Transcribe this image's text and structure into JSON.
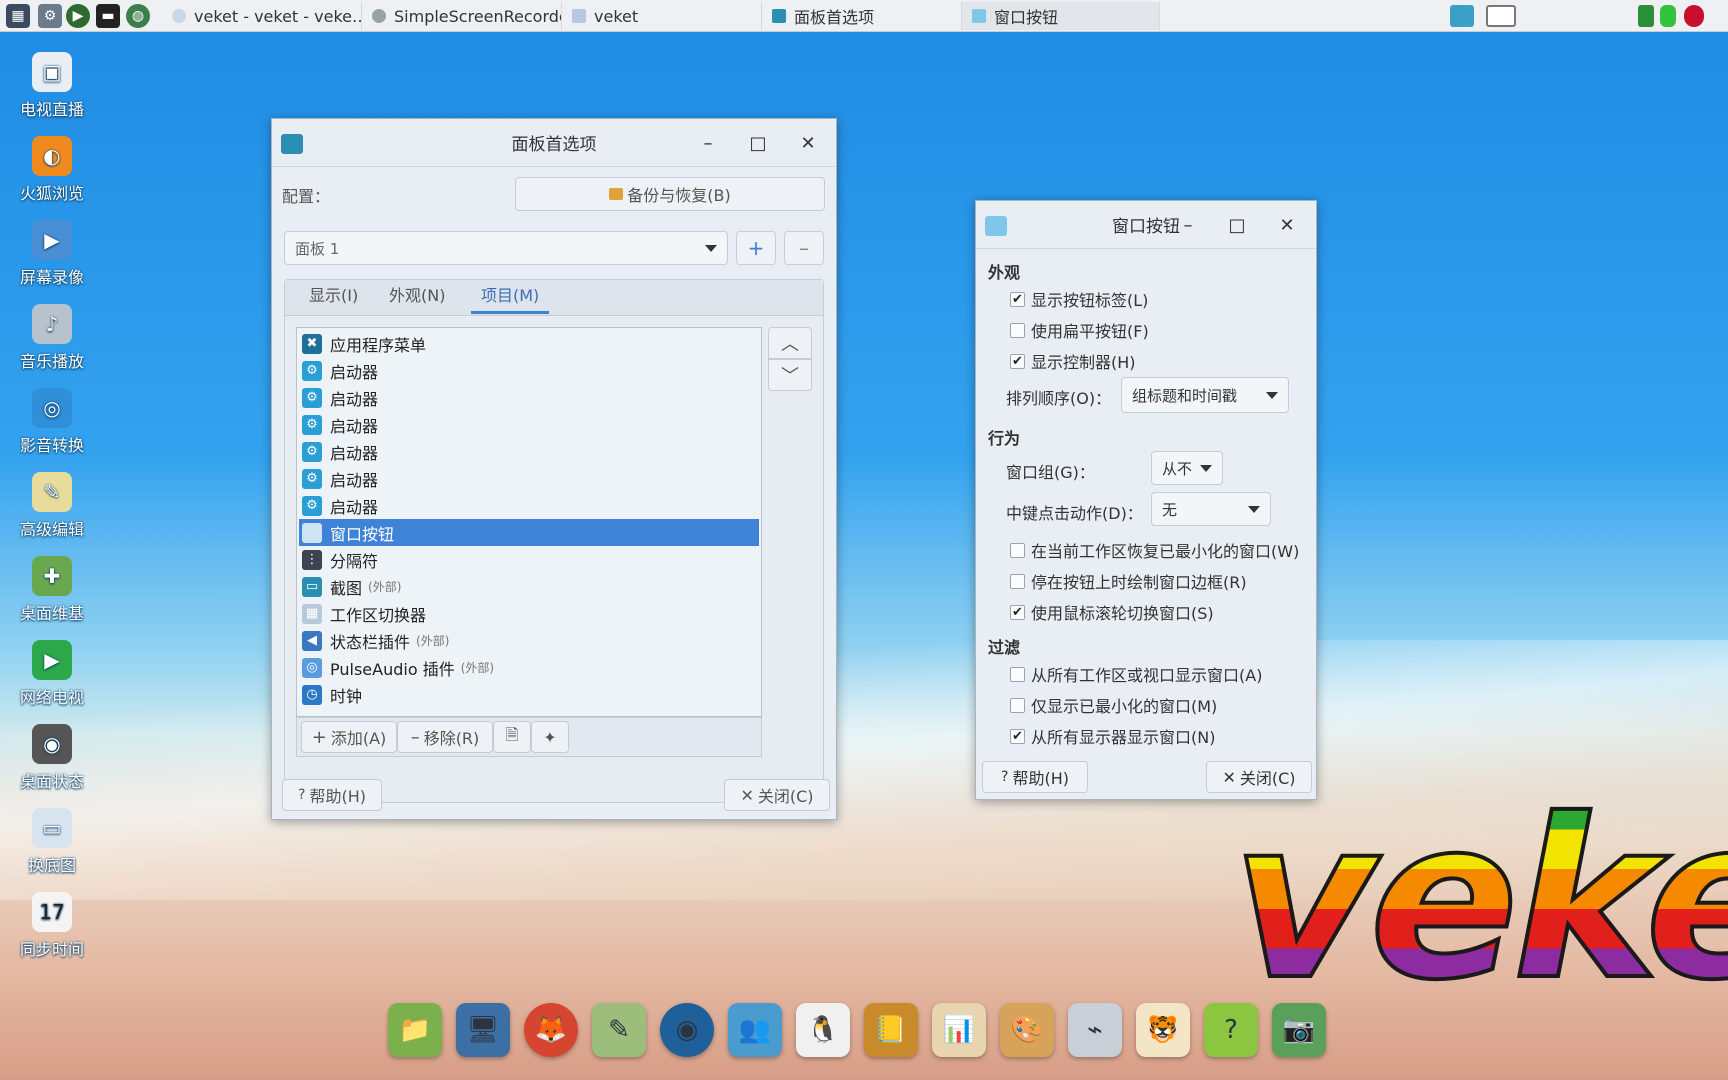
{
  "taskbar": {
    "tasks": [
      {
        "label": "veket - veket - veke…"
      },
      {
        "label": "SimpleScreenRecorder"
      },
      {
        "label": "veket"
      },
      {
        "label": "面板首选项"
      },
      {
        "label": "窗口按钮"
      }
    ]
  },
  "desktop_icons": [
    {
      "label": "电视直播",
      "icon": "tv-icon"
    },
    {
      "label": "火狐浏览",
      "icon": "firefox-icon"
    },
    {
      "label": "屏幕录像",
      "icon": "screen-record-icon"
    },
    {
      "label": "音乐播放",
      "icon": "speaker-icon"
    },
    {
      "label": "影音转换",
      "icon": "media-convert-icon"
    },
    {
      "label": "高级编辑",
      "icon": "text-editor-icon"
    },
    {
      "label": "桌面维基",
      "icon": "desktop-wiki-icon"
    },
    {
      "label": "网络电视",
      "icon": "play-icon"
    },
    {
      "label": "桌面状态",
      "icon": "desktop-status-icon"
    },
    {
      "label": "换底图",
      "icon": "monitor-icon"
    },
    {
      "label": "同步时间",
      "icon": "calendar-icon",
      "day": "17"
    }
  ],
  "panel_prefs": {
    "title": "面板首选项",
    "config_label": "配置：",
    "backup_button": "备份与恢复(B)",
    "panel_combo": "面板 1",
    "tabs": [
      "显示(I)",
      "外观(N)",
      "项目(M)"
    ],
    "selected_tab": "项目(M)",
    "items": [
      {
        "label": "应用程序菜单",
        "ext": "",
        "icon": "app-menu-icon"
      },
      {
        "label": "启动器",
        "ext": "",
        "icon": "launcher-icon"
      },
      {
        "label": "启动器",
        "ext": "",
        "icon": "launcher-icon"
      },
      {
        "label": "启动器",
        "ext": "",
        "icon": "launcher-icon"
      },
      {
        "label": "启动器",
        "ext": "",
        "icon": "launcher-icon"
      },
      {
        "label": "启动器",
        "ext": "",
        "icon": "launcher-icon"
      },
      {
        "label": "启动器",
        "ext": "",
        "icon": "launcher-icon"
      },
      {
        "label": "窗口按钮",
        "ext": "",
        "icon": "window-buttons-icon",
        "selected": true
      },
      {
        "label": "分隔符",
        "ext": "",
        "icon": "separator-icon"
      },
      {
        "label": "截图",
        "ext": "(外部)",
        "icon": "screenshot-icon"
      },
      {
        "label": "工作区切换器",
        "ext": "",
        "icon": "workspace-switcher-icon"
      },
      {
        "label": "状态栏插件",
        "ext": "(外部)",
        "icon": "status-tray-icon"
      },
      {
        "label": "PulseAudio 插件",
        "ext": "(外部)",
        "icon": "pulseaudio-icon"
      },
      {
        "label": "时钟",
        "ext": "",
        "icon": "clock-icon"
      }
    ],
    "add_button": "添加(A)",
    "remove_button": "移除(R)",
    "help_button": "帮助(H)",
    "close_button": "关闭(C)"
  },
  "window_buttons": {
    "title": "窗口按钮",
    "appearance_heading": "外观",
    "show_labels": {
      "label": "显示按钮标签(L)",
      "checked": true
    },
    "flat_buttons": {
      "label": "使用扁平按钮(F)",
      "checked": false
    },
    "show_handle": {
      "label": "显示控制器(H)",
      "checked": true
    },
    "sort_order_label": "排列顺序(O)：",
    "sort_order_value": "组标题和时间戳",
    "behavior_heading": "行为",
    "window_group_label": "窗口组(G)：",
    "window_group_value": "从不",
    "middle_click_label": "中键点击动作(D)：",
    "middle_click_value": "无",
    "restore_minimized": {
      "label": "在当前工作区恢复已最小化的窗口(W)",
      "checked": false
    },
    "draw_border": {
      "label": "停在按钮上时绘制窗口边框(R)",
      "checked": false
    },
    "scroll_switch": {
      "label": "使用鼠标滚轮切换窗口(S)",
      "checked": true
    },
    "filter_heading": "过滤",
    "all_workspaces": {
      "label": "从所有工作区或视口显示窗口(A)",
      "checked": false
    },
    "only_minimized": {
      "label": "仅显示已最小化的窗口(M)",
      "checked": false
    },
    "all_monitors": {
      "label": "从所有显示器显示窗口(N)",
      "checked": true
    },
    "help_button": "帮助(H)",
    "close_button": "关闭(C)"
  },
  "logo_text": "veke",
  "check_glyph": "✔"
}
